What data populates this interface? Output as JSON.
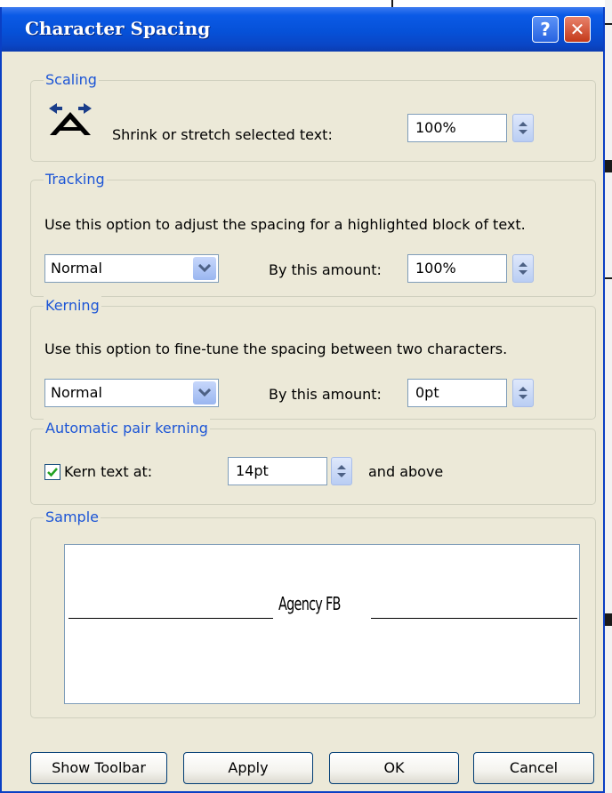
{
  "dialog": {
    "title": "Character Spacing",
    "help_glyph": "?",
    "close_glyph": "✕"
  },
  "scaling": {
    "label": "Scaling",
    "icon": "stretch-text-icon",
    "text": "Shrink or stretch selected text:",
    "value": "100%"
  },
  "tracking": {
    "label": "Tracking",
    "description": "Use this option to adjust the spacing for a highlighted block of text.",
    "dropdown_value": "Normal",
    "amount_label": "By this amount:",
    "amount_value": "100%"
  },
  "kerning": {
    "label": "Kerning",
    "description": "Use this option to fine-tune the spacing between two characters.",
    "dropdown_value": "Normal",
    "amount_label": "By this amount:",
    "amount_value": "0pt"
  },
  "auto_kerning": {
    "label": "Automatic pair kerning",
    "checkbox_label": "Kern text at:",
    "checked": true,
    "value": "14pt",
    "suffix": "and above"
  },
  "sample": {
    "label": "Sample",
    "font_name": "Agency FB"
  },
  "buttons": {
    "show_toolbar": "Show Toolbar",
    "apply": "Apply",
    "ok": "OK",
    "cancel": "Cancel"
  },
  "colors": {
    "titlebar": "#0651d8",
    "group_label": "#1c55d6",
    "dialog_bg": "#ece9d8",
    "close_button": "#c4391a"
  }
}
